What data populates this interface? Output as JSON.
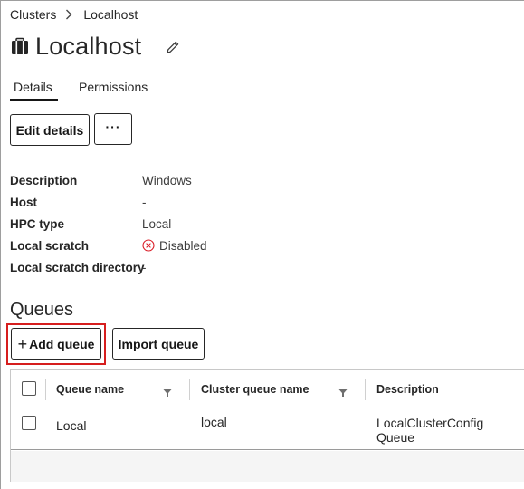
{
  "breadcrumb": {
    "root": "Clusters",
    "current": "Localhost"
  },
  "page": {
    "title": "Localhost"
  },
  "tabs": [
    {
      "label": "Details",
      "active": true
    },
    {
      "label": "Permissions",
      "active": false
    }
  ],
  "toolbar": {
    "edit_label": "Edit details",
    "more_label": "···"
  },
  "details": {
    "description": {
      "label": "Description",
      "value": "Windows"
    },
    "host": {
      "label": "Host",
      "value": "-"
    },
    "hpc_type": {
      "label": "HPC type",
      "value": "Local"
    },
    "local_scratch": {
      "label": "Local scratch",
      "value": "Disabled"
    },
    "local_scratch_dir": {
      "label": "Local scratch directory",
      "value": "-"
    }
  },
  "queues": {
    "title": "Queues",
    "add_label": "Add queue",
    "import_label": "Import queue",
    "columns": {
      "queue_name": "Queue name",
      "cluster_queue_name": "Cluster queue name",
      "description": "Description"
    },
    "rows": [
      {
        "queue_name": "Local",
        "cluster_queue_name": "local",
        "description": "LocalClusterConfig Queue"
      }
    ]
  },
  "colors": {
    "highlight": "#d61e1e",
    "disabled_icon": "#da1e28",
    "text": "#262626"
  },
  "icons": {
    "chevron": "chevron-right-icon",
    "cluster": "cluster-icon",
    "edit": "pencil-icon",
    "status": "close-circle-icon",
    "filter": "filter-icon"
  }
}
